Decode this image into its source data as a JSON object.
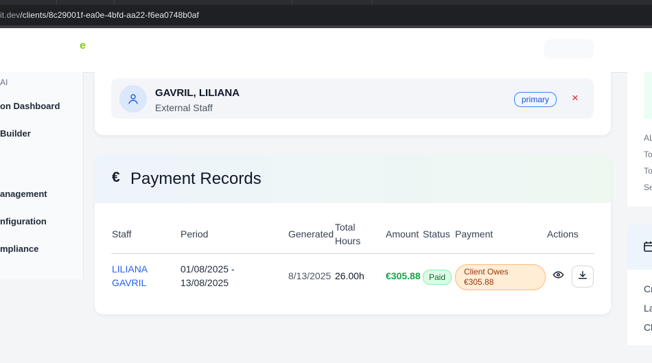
{
  "browser": {
    "url_host": "it.dev",
    "url_path": "/clients/8c29001f-ea0e-4bfd-aa22-f6ea0748b0af"
  },
  "header": {
    "brand_fragment": "e"
  },
  "sidebar": {
    "section_label": "AI",
    "items": [
      {
        "label": "on Dashboard"
      },
      {
        "label": "Builder"
      },
      {
        "label": "anagement"
      },
      {
        "label": "nfiguration"
      },
      {
        "label": "mpliance"
      }
    ]
  },
  "assigned_staff": {
    "name": "GAVRIL, LILIANA",
    "type": "External Staff",
    "role_badge": "primary",
    "remove_label": "×",
    "icons": {
      "avatar": "user-icon",
      "remove": "close-icon"
    }
  },
  "payments": {
    "title": "Payment Records",
    "title_icon": "€",
    "columns": {
      "staff": "Staff",
      "period": "Period",
      "generated": "Generated",
      "total_hours_1": "Total",
      "total_hours_2": "Hours",
      "amount": "Amount",
      "status": "Status",
      "payment": "Payment",
      "actions": "Actions"
    },
    "rows": [
      {
        "staff_line1": "LILIANA",
        "staff_line2": "GAVRIL",
        "period_line1": "01/08/2025 -",
        "period_line2": "13/08/2025",
        "generated": "8/13/2025",
        "total_hours": "26.00h",
        "amount": "€305.88",
        "status": "Paid",
        "payment_line1": "Client Owes",
        "payment_line2": "€305.88",
        "actions": [
          "eye-icon",
          "download-icon"
        ]
      }
    ]
  },
  "right_panel": {
    "lines": [
      "AL",
      "To",
      "To",
      "Se"
    ],
    "items": [
      "Cr",
      "La",
      "Cl"
    ],
    "icons": {
      "calendar": "calendar-icon"
    }
  },
  "colors": {
    "accent_blue": "#2563eb",
    "paid_green": "#16a34a",
    "owes_orange": "#9a3412",
    "remove_red": "#dc2626",
    "brand_green": "#84cc16"
  }
}
